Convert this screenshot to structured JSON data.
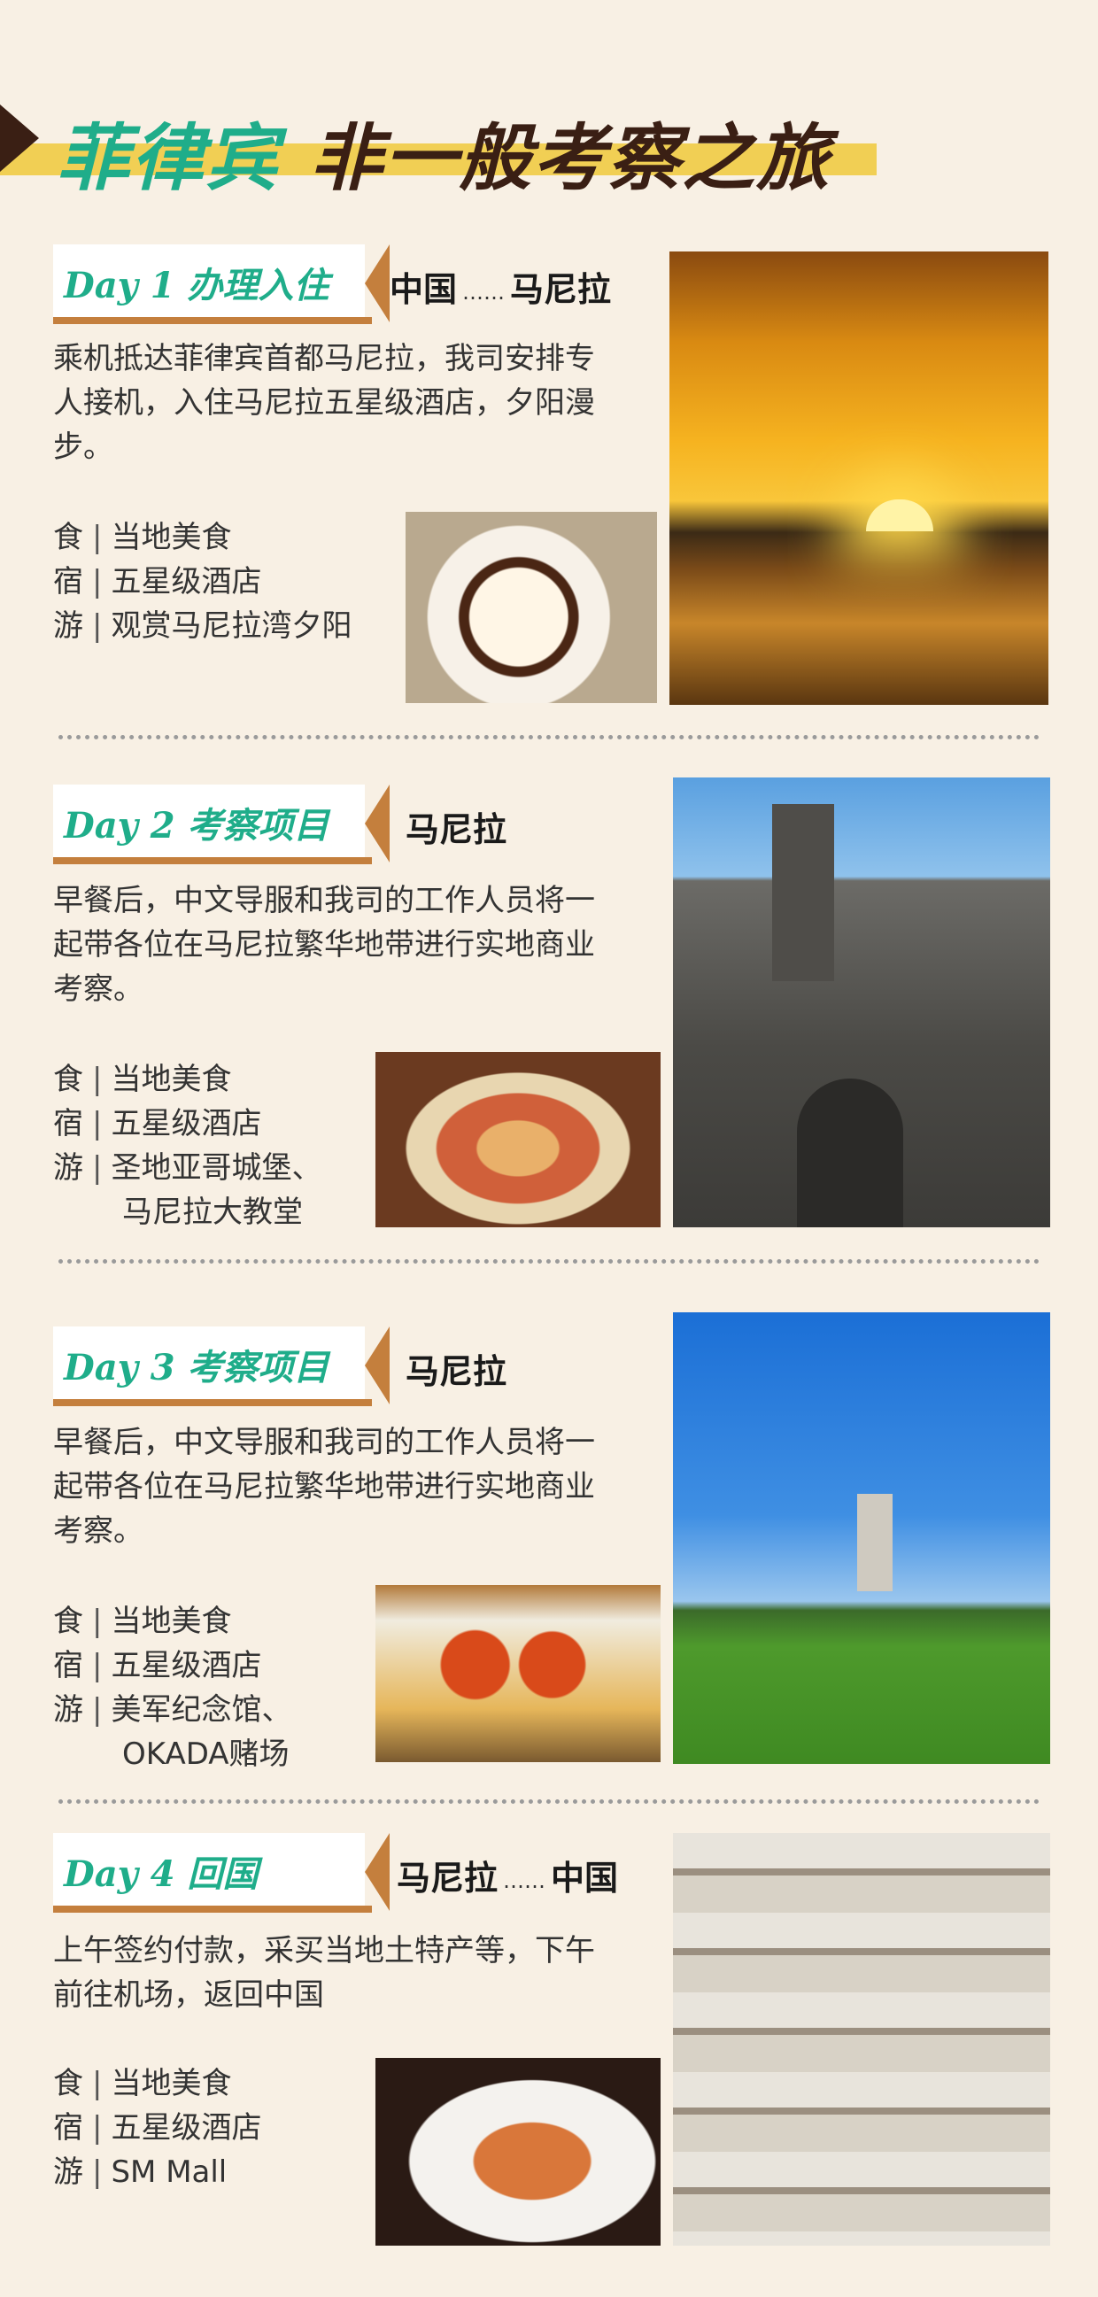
{
  "title": {
    "part1": "菲律宾",
    "part2": "非一般考察之旅"
  },
  "labels": {
    "food": "食",
    "stay": "宿",
    "tour": "游",
    "separator": "|",
    "route_dots": "……"
  },
  "days": [
    {
      "tag": "Day 1 办理入住",
      "route_from": "中国",
      "route_to": "马尼拉",
      "desc": "乘机抵达菲律宾首都马尼拉，我司安排专人接机，入住马尼拉五星级酒店，夕阳漫步。",
      "food": "当地美食",
      "stay": "五星级酒店",
      "tour": [
        "观赏马尼拉湾夕阳"
      ]
    },
    {
      "tag": "Day 2 考察项目",
      "route_from": "马尼拉",
      "route_to": "",
      "desc": "早餐后，中文导服和我司的工作人员将一起带各位在马尼拉繁华地带进行实地商业考察。",
      "food": "当地美食",
      "stay": "五星级酒店",
      "tour": [
        "圣地亚哥城堡、",
        "马尼拉大教堂"
      ]
    },
    {
      "tag": "Day 3 考察项目",
      "route_from": "马尼拉",
      "route_to": "",
      "desc": "早餐后，中文导服和我司的工作人员将一起带各位在马尼拉繁华地带进行实地商业考察。",
      "food": "当地美食",
      "stay": "五星级酒店",
      "tour": [
        "美军纪念馆、",
        "OKADA赌场"
      ]
    },
    {
      "tag": "Day 4 回国",
      "route_from": "马尼拉",
      "route_to": "中国",
      "desc": "上午签约付款，采买当地土特产等，下午前往机场，返回中国",
      "food": "当地美食",
      "stay": "五星级酒店",
      "tour": [
        "SM Mall"
      ]
    }
  ],
  "images": [
    "sunset-photo",
    "dessert-photo",
    "cathedral-photo",
    "seafood-photo",
    "memorial-photo",
    "crab-photo",
    "mall-photo",
    "salmon-photo"
  ]
}
